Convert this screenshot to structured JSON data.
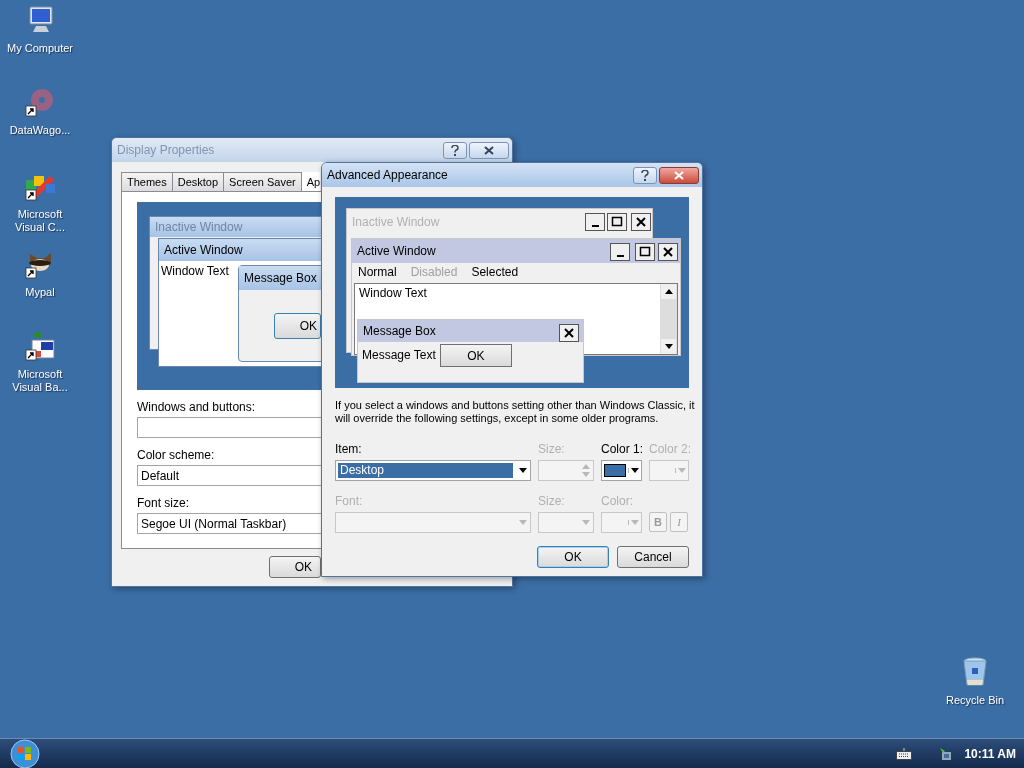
{
  "desktop_icons": [
    {
      "label": "My Computer",
      "kind": "computer",
      "shortcut": false
    },
    {
      "label": "DataWago...",
      "kind": "disc",
      "shortcut": true
    },
    {
      "label": "Microsoft Visual C...",
      "kind": "puzzle",
      "shortcut": true
    },
    {
      "label": "Mypal",
      "kind": "animal",
      "shortcut": true
    },
    {
      "label": "Microsoft Visual Ba...",
      "kind": "setup",
      "shortcut": true
    },
    {
      "label": "Recycle Bin",
      "kind": "bin",
      "shortcut": false
    }
  ],
  "display_properties": {
    "title": "Display Properties",
    "active": false,
    "tabs": [
      {
        "label": "Themes",
        "selected": false
      },
      {
        "label": "Desktop",
        "selected": false
      },
      {
        "label": "Screen Saver",
        "selected": false
      },
      {
        "label": "Ap",
        "selected": true
      }
    ],
    "preview": {
      "inactive_title": "Inactive Window",
      "active_title": "Active Window",
      "window_text": "Window Text",
      "message_title": "Message Box",
      "ok": "OK"
    },
    "fields": [
      {
        "label": "Windows and buttons:"
      },
      {
        "label": "Color scheme:",
        "value": "Default"
      },
      {
        "label": "Font size:",
        "value": "Segoe UI (Normal Taskbar)"
      }
    ],
    "ok_button": "OK"
  },
  "advanced_appearance": {
    "title": "Advanced Appearance",
    "active": true,
    "preview": {
      "inactive_title": "Inactive Window",
      "active_title": "Active Window",
      "menu": [
        {
          "label": "Normal",
          "kind": "normal"
        },
        {
          "label": "Disabled",
          "kind": "disabled"
        },
        {
          "label": "Selected",
          "kind": "selected"
        }
      ],
      "window_text": "Window Text",
      "message_title": "Message Box",
      "message_text": "Message Text",
      "ok": "OK"
    },
    "note": "If you select a windows and buttons setting other than Windows Classic, it will override the following settings, except in some older programs.",
    "item_row": [
      {
        "label": "Item:",
        "kind": "dropdown",
        "disabled": false,
        "value": "Desktop"
      },
      {
        "label": "Size:",
        "kind": "spinner",
        "disabled": true
      },
      {
        "label": "Color 1:",
        "kind": "color",
        "disabled": false,
        "color": "#3a6ea5"
      },
      {
        "label": "Color 2:",
        "kind": "color",
        "disabled": true
      }
    ],
    "font_row": [
      {
        "label": "Font:",
        "kind": "dropdown",
        "disabled": true
      },
      {
        "label": "Size:",
        "kind": "dropdown",
        "disabled": true
      },
      {
        "label": "Color:",
        "kind": "color",
        "disabled": true
      }
    ],
    "style_buttons": [
      {
        "label": "B",
        "kind": "bold",
        "disabled": true
      },
      {
        "label": "I",
        "kind": "italic",
        "disabled": true
      }
    ],
    "buttons": [
      {
        "label": "OK",
        "default": true
      },
      {
        "label": "Cancel",
        "default": false
      }
    ]
  },
  "taskbar": {
    "clock": "10:11 AM"
  }
}
